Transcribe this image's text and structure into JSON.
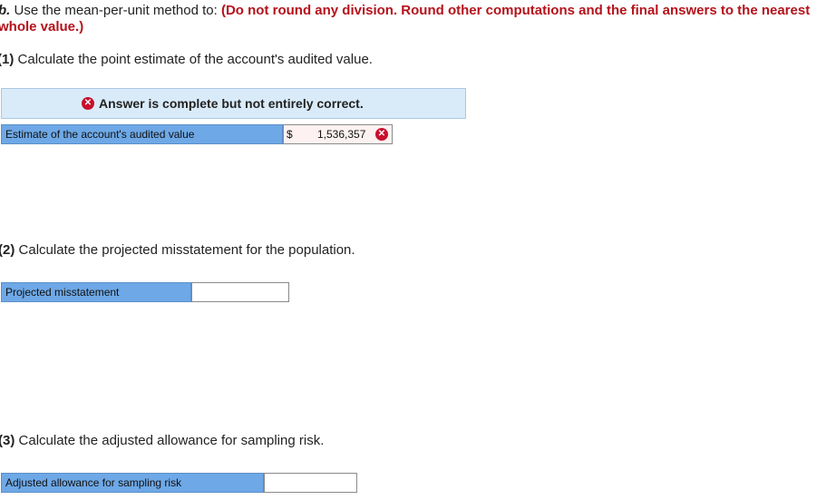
{
  "instruction": {
    "part": "b.",
    "text": "Use the mean-per-unit method to:",
    "note_line1": "(Do not round any division. Round other computations and the final answers to the nearest",
    "note_line2": "whole value.)"
  },
  "q1": {
    "number": "(1)",
    "text": "Calculate the point estimate of the account's audited value.",
    "banner": "Answer is complete but not entirely correct.",
    "row_label": "Estimate of the account's audited value",
    "currency": "$",
    "value": "1,536,357",
    "status_icon": "x-circle-icon"
  },
  "q2": {
    "number": "(2)",
    "text": "Calculate the projected misstatement for the population.",
    "row_label": "Projected misstatement",
    "value": ""
  },
  "q3": {
    "number": "(3)",
    "text": "Calculate the adjusted allowance for sampling risk.",
    "row_label": "Adjusted allowance for sampling risk",
    "value": ""
  },
  "colors": {
    "accent_red": "#b5121b",
    "label_blue": "#6ea8e6",
    "banner_blue": "#d9ebf9",
    "error_red": "#c8102e"
  }
}
